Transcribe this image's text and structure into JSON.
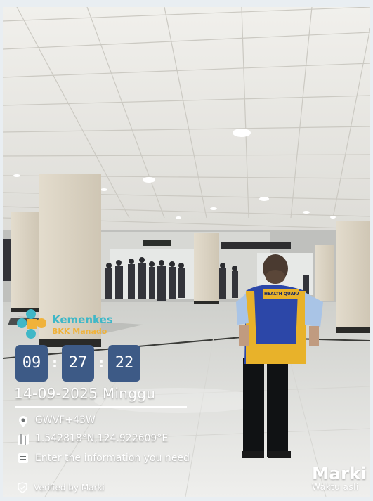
{
  "stamp": {
    "logo": {
      "name": "Kemenkes",
      "subtitle": "BKK Manado",
      "icon": "kemenkes-logo-icon"
    },
    "time": {
      "hours": "09",
      "minutes": "27",
      "seconds": "22",
      "separator": ":"
    },
    "date_line": "14-09-2025 Minggu",
    "plus_code": "GWVF+43W",
    "coordinates": "1.542818°N,124.922609°E",
    "note": "Enter the information you need",
    "verified": "Verified by Marki"
  },
  "brand": {
    "name": "Marki",
    "tagline": "Waktu asli"
  },
  "vest_label": "HEALTH QUARANTINE",
  "signage": {
    "gate_sign": "■ ▶",
    "exit_sign": ""
  },
  "colors": {
    "time_box": "#3d5a86",
    "vest_blue": "#2c47a8",
    "vest_yellow": "#e8b22a",
    "logo_teal": "#3fb7c7",
    "logo_orange": "#f0b23a"
  },
  "icons": [
    "location-pin-icon",
    "map-icon",
    "note-icon",
    "shield-check-icon"
  ]
}
